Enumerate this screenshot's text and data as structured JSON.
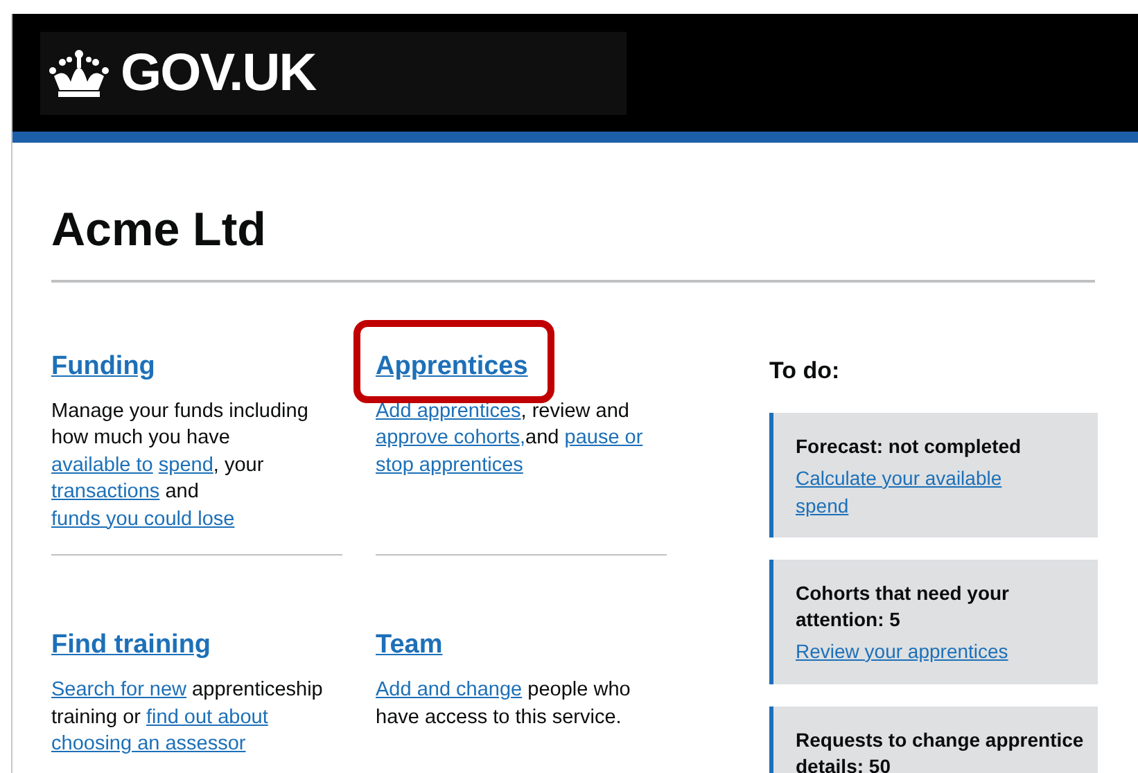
{
  "header": {
    "logo": "GOV.UK"
  },
  "page": {
    "title": "Acme Ltd"
  },
  "sections": [
    {
      "heading": "Funding",
      "highlighted": false,
      "body": [
        {
          "kind": "text",
          "text": "Manage your funds including how much you have "
        },
        {
          "kind": "link",
          "text": "available to"
        },
        {
          "kind": "link",
          "text": "spend"
        },
        {
          "kind": "text",
          "text": ", your "
        },
        {
          "kind": "link",
          "text": "transactions"
        },
        {
          "kind": "text",
          "text": " and "
        },
        {
          "kind": "link",
          "text": "funds you could lose"
        }
      ]
    },
    {
      "heading": "Apprentices",
      "highlighted": true,
      "body": [
        {
          "kind": "link",
          "text": "Add apprentices"
        },
        {
          "kind": "text",
          "text": ", review and "
        },
        {
          "kind": "link",
          "text": "approve cohorts,"
        },
        {
          "kind": "text",
          "text": "and "
        },
        {
          "kind": "link",
          "text": "pause or"
        },
        {
          "kind": "link",
          "text": "stop apprentices"
        }
      ]
    },
    {
      "heading": "Find training",
      "highlighted": false,
      "body": [
        {
          "kind": "link",
          "text": "Search for new"
        },
        {
          "kind": "text",
          "text": " apprenticeship training or "
        },
        {
          "kind": "link",
          "text": "find out about"
        },
        {
          "kind": "link",
          "text": "choosing an assessor"
        }
      ]
    },
    {
      "heading": "Team",
      "highlighted": false,
      "body": [
        {
          "kind": "link",
          "text": "Add and change"
        },
        {
          "kind": "text",
          "text": " people who have access to this service."
        }
      ]
    }
  ],
  "todo": {
    "heading": "To do:",
    "items": [
      {
        "title": "Forecast: not completed",
        "link": "Calculate your available spend"
      },
      {
        "title": "Cohorts that need your attention: 5",
        "link": "Review your apprentices"
      },
      {
        "title": "Requests to change apprentice details: 50"
      }
    ]
  }
}
